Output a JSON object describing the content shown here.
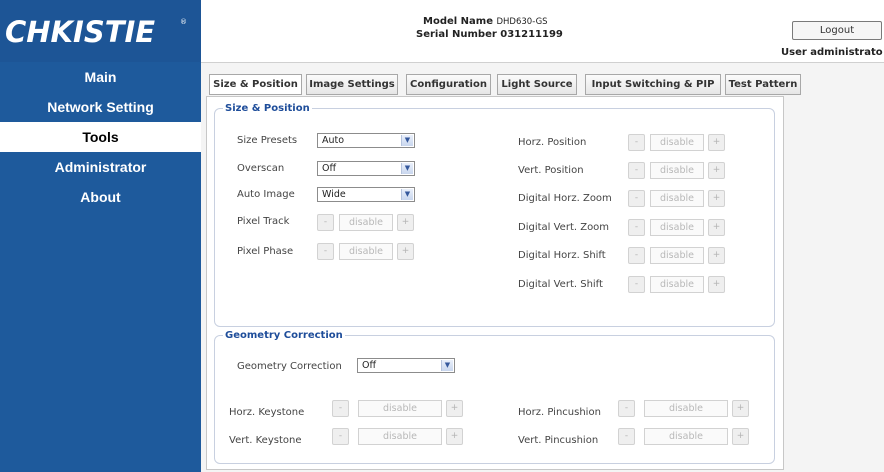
{
  "brand": {
    "logo": "CHKISTIE",
    "reg": "®"
  },
  "header": {
    "model_label": "Model Name",
    "model_value": "DHD630-GS",
    "serial_label": "Serial Number",
    "serial_value": "031211199",
    "logout_label": "Logout",
    "user_text": "User administrato"
  },
  "nav": {
    "items": [
      {
        "label": "Main"
      },
      {
        "label": "Network Setting"
      },
      {
        "label": "Tools"
      },
      {
        "label": "Administrator"
      },
      {
        "label": "About"
      }
    ],
    "active": "Tools"
  },
  "tabs": [
    {
      "label": "Size & Position"
    },
    {
      "label": "Image Settings"
    },
    {
      "label": "Configuration"
    },
    {
      "label": "Light Source"
    },
    {
      "label": "Input Switching & PIP"
    },
    {
      "label": "Test Pattern"
    }
  ],
  "active_tab": "Size & Position",
  "size_position": {
    "title": "Size & Position",
    "size_presets": {
      "label": "Size Presets",
      "value": "Auto"
    },
    "overscan": {
      "label": "Overscan",
      "value": "Off"
    },
    "auto_image": {
      "label": "Auto Image",
      "value": "Wide"
    },
    "pixel_track": {
      "label": "Pixel Track",
      "value": "disable"
    },
    "pixel_phase": {
      "label": "Pixel Phase",
      "value": "disable"
    },
    "horz_position": {
      "label": "Horz. Position",
      "value": "disable"
    },
    "vert_position": {
      "label": "Vert. Position",
      "value": "disable"
    },
    "digital_horz_zoom": {
      "label": "Digital Horz. Zoom",
      "value": "disable"
    },
    "digital_vert_zoom": {
      "label": "Digital Vert. Zoom",
      "value": "disable"
    },
    "digital_horz_shift": {
      "label": "Digital Horz. Shift",
      "value": "disable"
    },
    "digital_vert_shift": {
      "label": "Digital Vert. Shift",
      "value": "disable"
    }
  },
  "geometry": {
    "title": "Geometry Correction",
    "correction": {
      "label": "Geometry Correction",
      "value": "Off"
    },
    "horz_keystone": {
      "label": "Horz. Keystone",
      "value": "disable"
    },
    "vert_keystone": {
      "label": "Vert. Keystone",
      "value": "disable"
    },
    "horz_pincushion": {
      "label": "Horz. Pincushion",
      "value": "disable"
    },
    "vert_pincushion": {
      "label": "Vert. Pincushion",
      "value": "disable"
    }
  },
  "stepper": {
    "minus": "-",
    "plus": "+"
  },
  "dropdown_arrow": "▼",
  "colors": {
    "sidebar": "#1e5a9c",
    "legend": "#1e4d9a"
  }
}
